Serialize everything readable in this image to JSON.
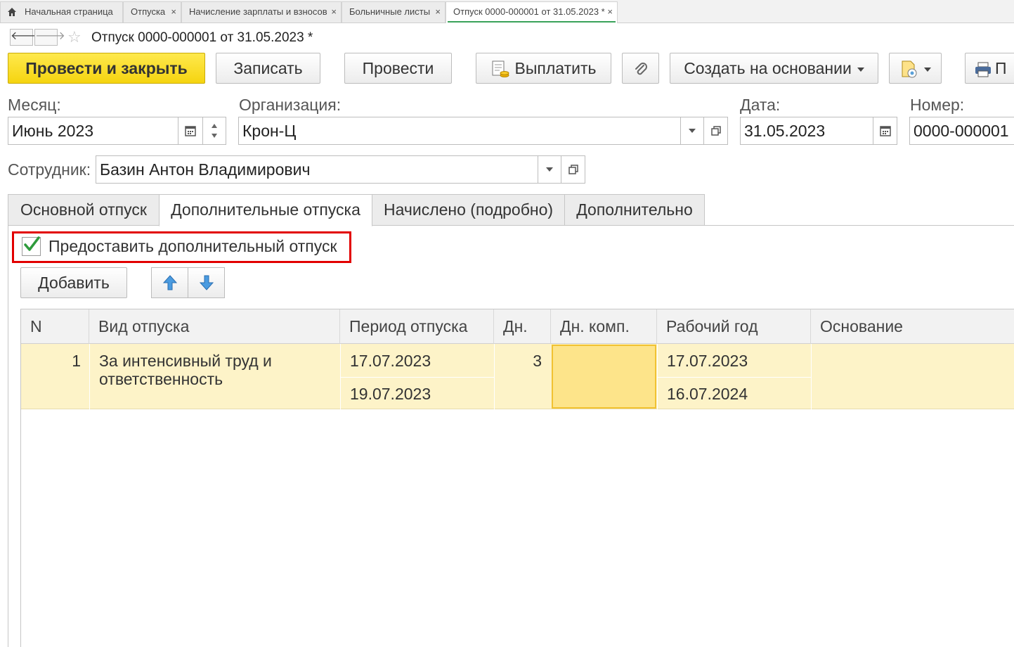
{
  "tabs": [
    {
      "label": "Начальная страница"
    },
    {
      "label": "Отпуска"
    },
    {
      "label": "Начисление зарплаты и взносов"
    },
    {
      "label": "Больничные листы"
    },
    {
      "label": "Отпуск 0000-000001 от 31.05.2023 *"
    }
  ],
  "tab_close_glyph": "×",
  "nav": {
    "back": "🡐",
    "forward": "🡒",
    "star": "☆"
  },
  "document": {
    "title": "Отпуск 0000-000001 от 31.05.2023 *"
  },
  "toolbar": {
    "post_close": "Провести и закрыть",
    "save": "Записать",
    "post": "Провести",
    "pay": "Выплатить",
    "create_based": "Создать на основании",
    "print_partial": "П"
  },
  "fields": {
    "month_label": "Месяц:",
    "month_value": "Июнь 2023",
    "org_label": "Организация:",
    "org_value": "Крон-Ц",
    "date_label": "Дата:",
    "date_value": "31.05.2023",
    "number_label": "Номер:",
    "number_value": "0000-000001",
    "employee_label": "Сотрудник:",
    "employee_value": "Базин Антон Владимирович"
  },
  "inner_tabs": [
    {
      "label": "Основной отпуск"
    },
    {
      "label": "Дополнительные отпуска"
    },
    {
      "label": "Начислено (подробно)"
    },
    {
      "label": "Дополнительно"
    }
  ],
  "extra_leave": {
    "checkbox_label": "Предоставить дополнительный отпуск",
    "checked": true
  },
  "table_toolbar": {
    "add": "Добавить"
  },
  "table": {
    "columns": [
      "N",
      "Вид отпуска",
      "Период отпуска",
      "Дн.",
      "Дн. комп.",
      "Рабочий год",
      "Основание"
    ],
    "rows": [
      {
        "n": "1",
        "kind_line1": "За интенсивный труд и",
        "kind_line2": "ответственность",
        "period_from": "17.07.2023",
        "period_to": "19.07.2023",
        "days": "3",
        "days_comp": "",
        "year_from": "17.07.2023",
        "year_to": "16.07.2024",
        "basis": ""
      }
    ]
  },
  "colors": {
    "accent_yellow": "#f5d410",
    "highlight_red": "#e20000",
    "active_tab_green": "#3aa25a",
    "row_selected": "#fdf3c8"
  }
}
